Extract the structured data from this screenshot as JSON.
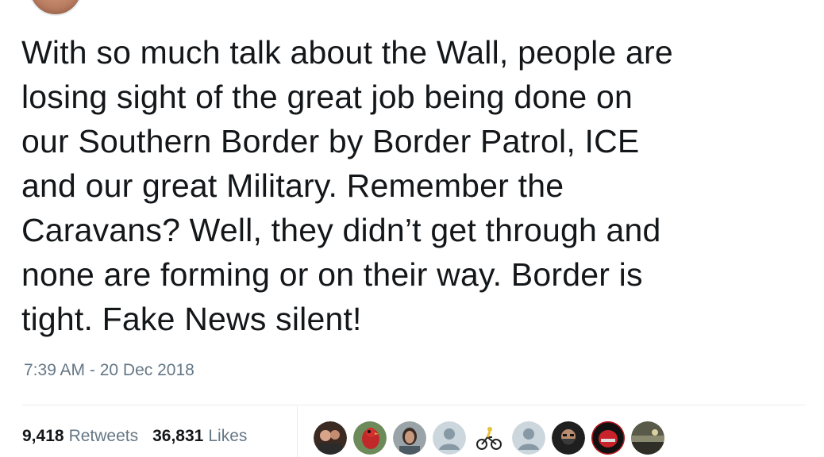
{
  "tweet": {
    "text": "With so much talk about the Wall, people are\nlosing sight of the great job being done on\nour Southern Border by Border Patrol, ICE\nand our great Military. Remember the\nCaravans? Well, they didn’t get through and\nnone are forming or on their way. Border is\ntight. Fake News silent!",
    "timestamp": "7:39 AM - 20 Dec 2018"
  },
  "stats": {
    "retweets_count": "9,418",
    "retweets_label": "Retweets",
    "likes_count": "36,831",
    "likes_label": "Likes"
  },
  "colors": {
    "text": "#14171a",
    "secondary": "#657786",
    "divider": "#e6ecf0",
    "brand": "#1da1f2"
  },
  "likers": [
    {
      "icon": "photo-avatar-couple-icon"
    },
    {
      "icon": "photo-avatar-bird-icon"
    },
    {
      "icon": "photo-avatar-person-icon"
    },
    {
      "icon": "default-avatar-icon"
    },
    {
      "icon": "cyclist-avatar-icon"
    },
    {
      "icon": "default-avatar-icon"
    },
    {
      "icon": "photo-avatar-bearded-man-icon"
    },
    {
      "icon": "photo-avatar-helmet-icon"
    },
    {
      "icon": "photo-avatar-landscape-icon"
    }
  ]
}
